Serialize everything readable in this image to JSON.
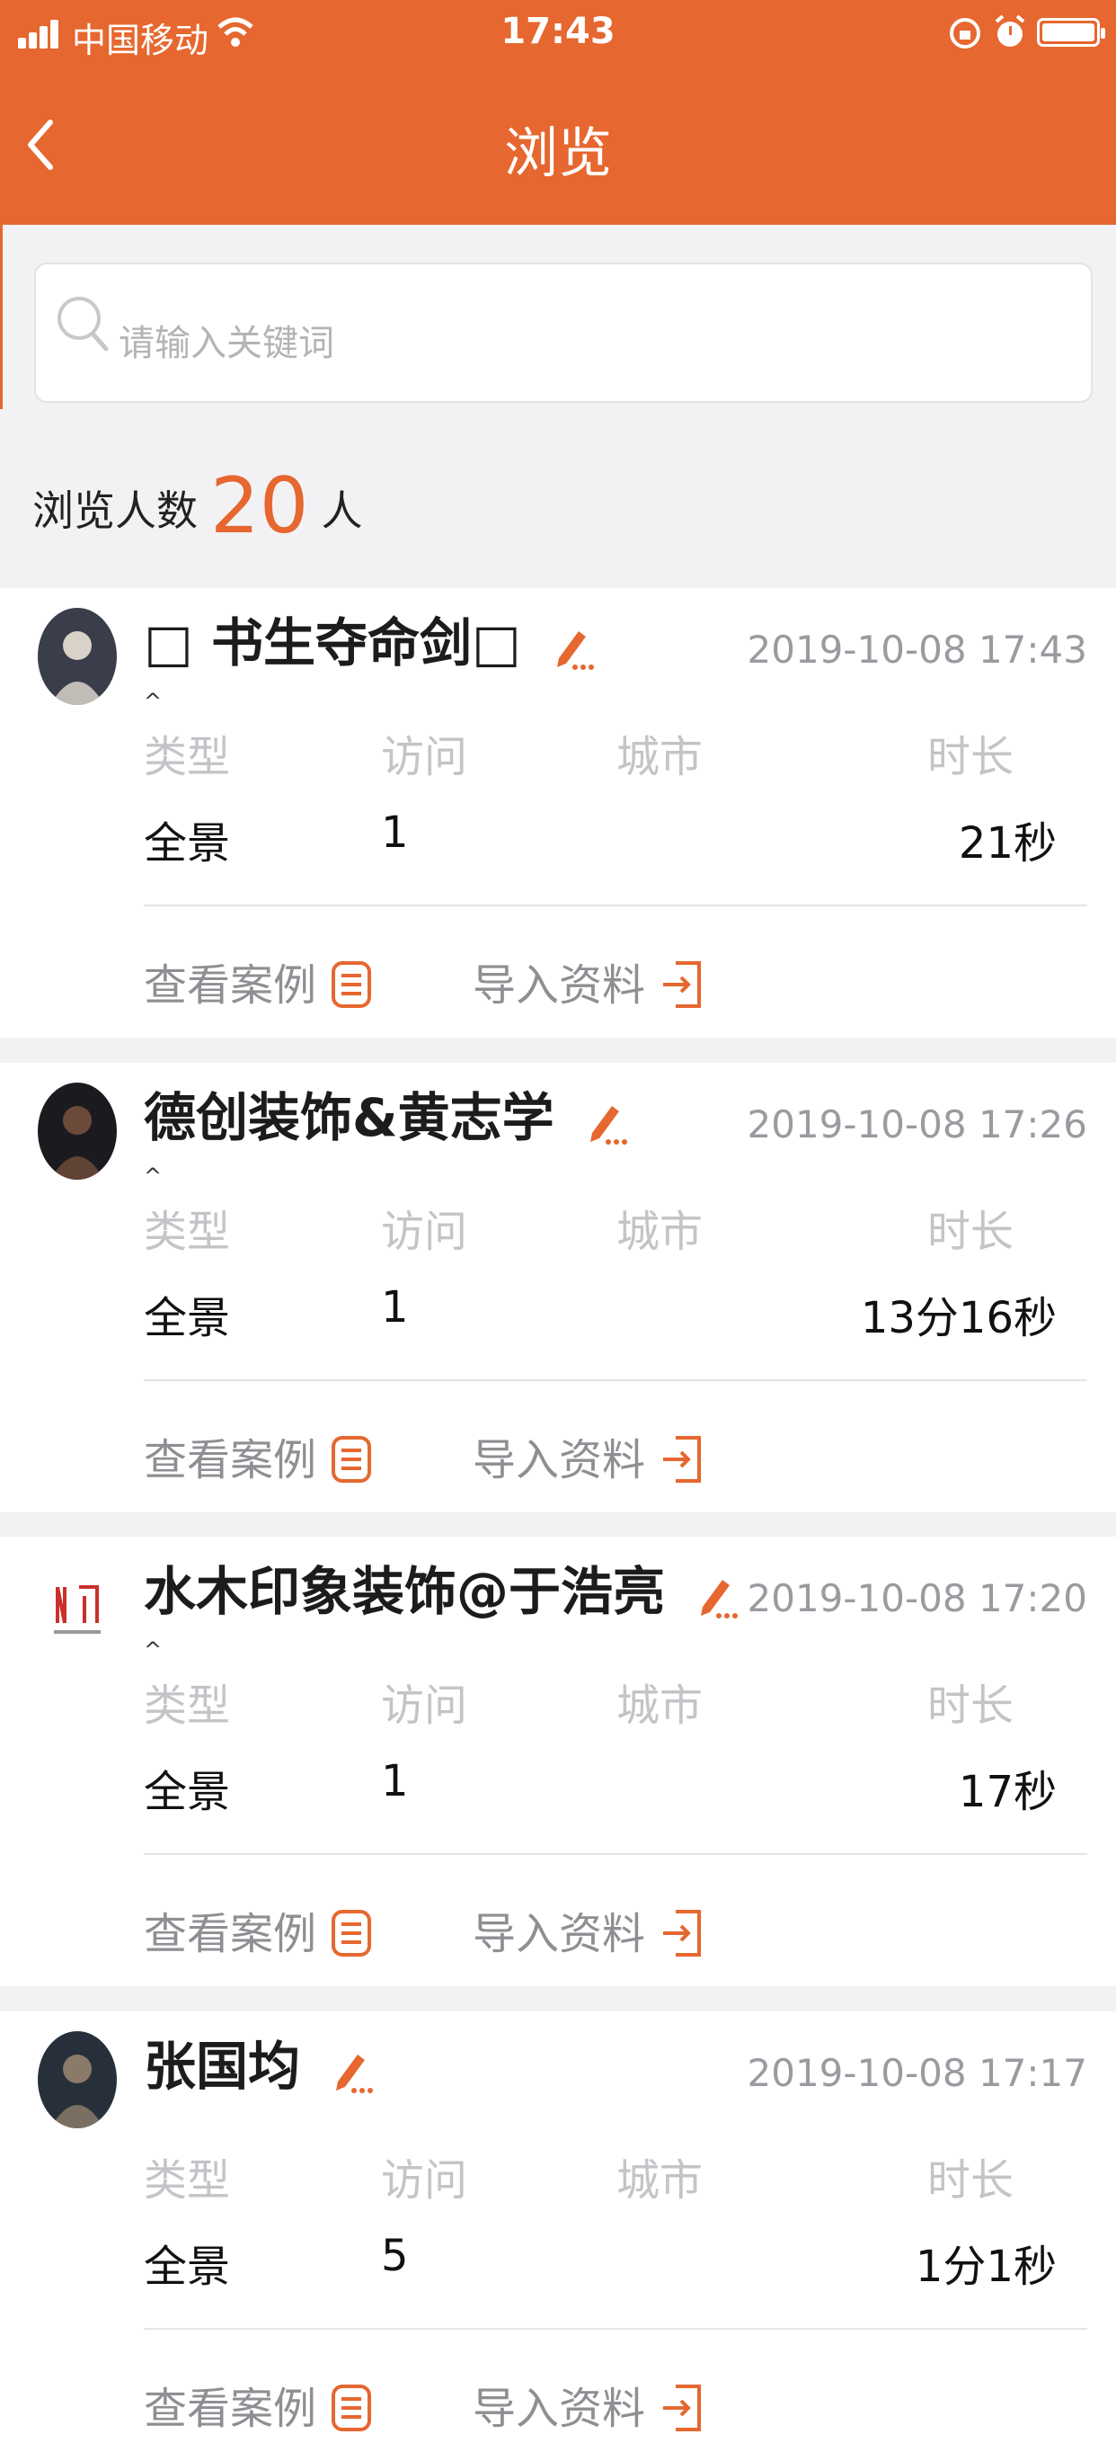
{
  "status_bar": {
    "carrier": "中国移动",
    "time": "17:43"
  },
  "header": {
    "title": "浏览"
  },
  "search": {
    "placeholder": "请输入关键词"
  },
  "summary": {
    "prefix": "浏览人数",
    "count": "20",
    "suffix": "人"
  },
  "columns": {
    "type": "类型",
    "visits": "访问",
    "city": "城市",
    "duration": "时长"
  },
  "actions": {
    "view_case": "查看案例",
    "import_data": "导入资料"
  },
  "colors": {
    "accent": "#e6672f"
  },
  "visitors": [
    {
      "name": "□ 书生夺命剑□",
      "caret": "^",
      "datetime": "2019-10-08 17:43",
      "type": "全景",
      "visits": "1",
      "city": "",
      "duration": "21秒",
      "avatar": "avatar-photo"
    },
    {
      "name": "德创装饰&黄志学",
      "caret": "^",
      "datetime": "2019-10-08 17:26",
      "type": "全景",
      "visits": "1",
      "city": "",
      "duration": "13分16秒",
      "avatar": "avatar-photo"
    },
    {
      "name": "水木印象装饰@于浩亮",
      "caret": "^",
      "datetime": "2019-10-08 17:20",
      "type": "全景",
      "visits": "1",
      "city": "",
      "duration": "17秒",
      "avatar": "company-logo"
    },
    {
      "name": "张国均",
      "caret": "",
      "datetime": "2019-10-08 17:17",
      "type": "全景",
      "visits": "5",
      "city": "",
      "duration": "1分1秒",
      "avatar": "avatar-photo"
    }
  ]
}
